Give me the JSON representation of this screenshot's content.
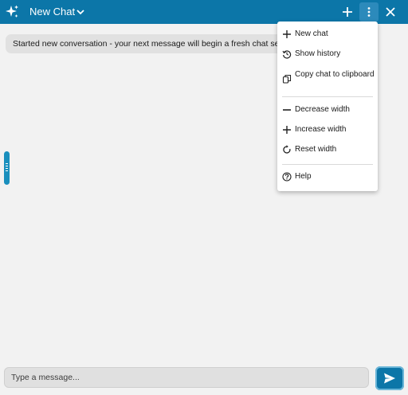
{
  "header": {
    "title": "New Chat",
    "icons": [
      "sparkle-icon",
      "chevron-down-icon",
      "plus-icon",
      "more-vert-icon",
      "close-icon"
    ]
  },
  "conversation": {
    "system_message": "Started new conversation - your next message will begin a fresh chat session."
  },
  "menu": {
    "items": [
      {
        "label": "New chat",
        "icon": "plus-icon"
      },
      {
        "label": "Show history",
        "icon": "history-icon"
      },
      {
        "label": "Copy chat to clipboard",
        "icon": "clipboard-icon"
      },
      {
        "label": "Decrease width",
        "icon": "minus-icon"
      },
      {
        "label": "Increase width",
        "icon": "plus-icon"
      },
      {
        "label": "Reset width",
        "icon": "reset-icon"
      },
      {
        "label": "Help",
        "icon": "help-icon"
      }
    ]
  },
  "composer": {
    "placeholder": "Type a message...",
    "send_icon": "send-icon"
  },
  "colors": {
    "accent": "#0c76a8",
    "background": "#f2f2f2"
  }
}
